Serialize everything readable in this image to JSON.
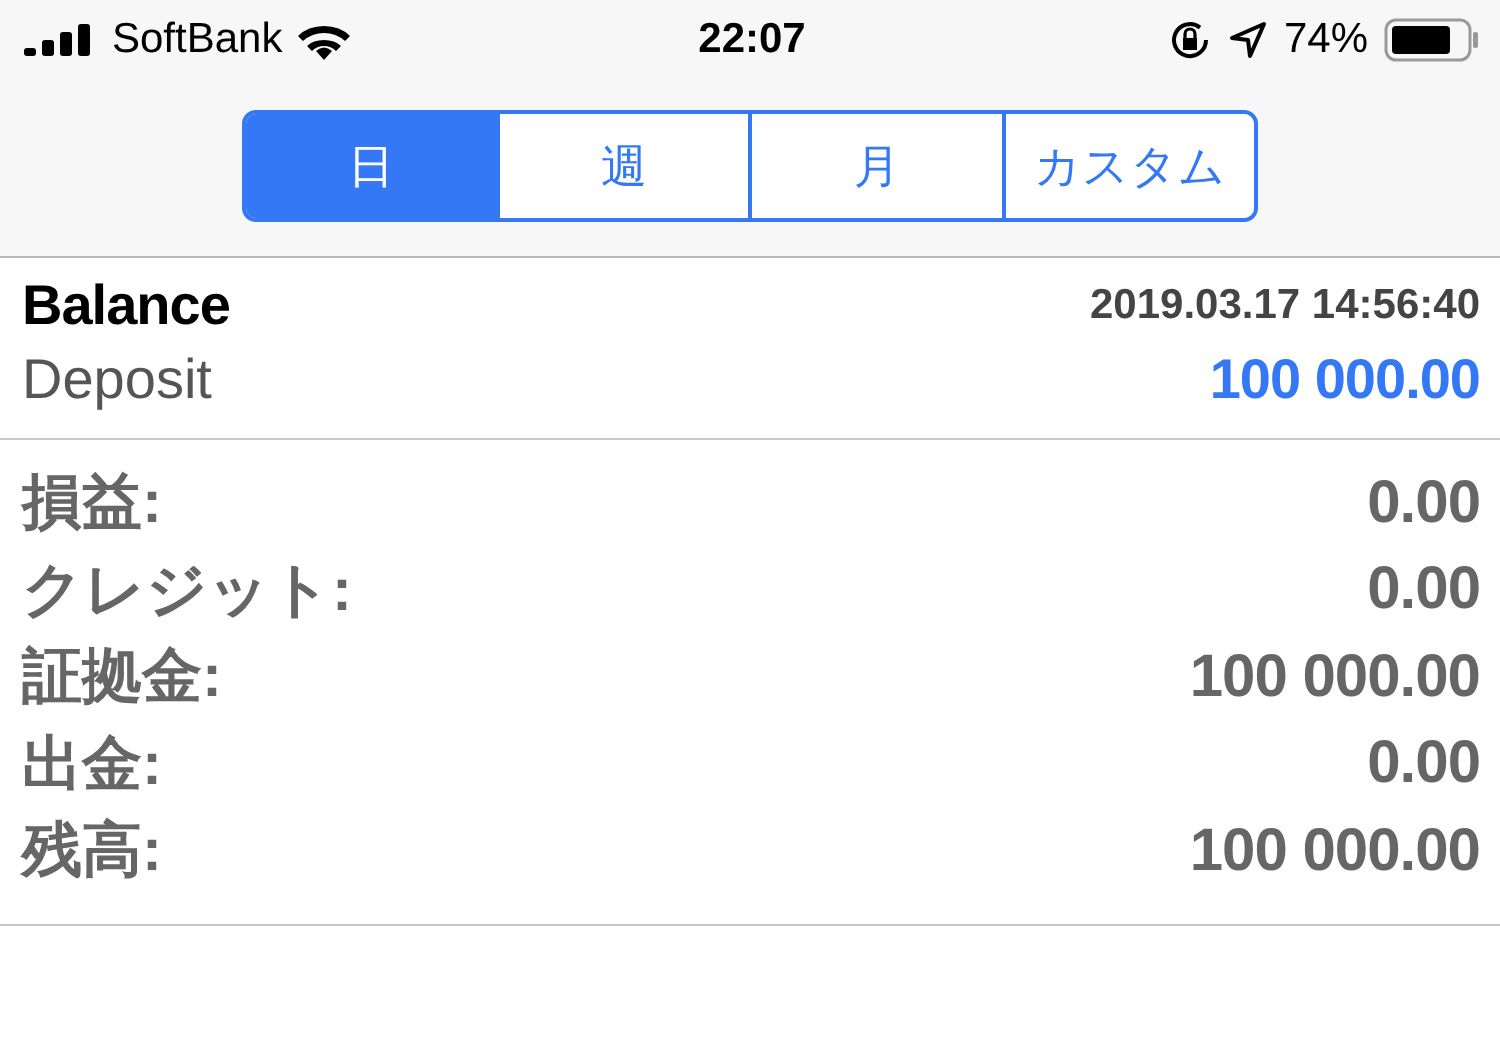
{
  "status_bar": {
    "carrier": "SoftBank",
    "time": "22:07",
    "battery": "74%"
  },
  "tabs": [
    {
      "label": "日",
      "selected": true
    },
    {
      "label": "週",
      "selected": false
    },
    {
      "label": "月",
      "selected": false
    },
    {
      "label": "カスタム",
      "selected": false
    }
  ],
  "operation": {
    "title": "Balance",
    "datetime": "2019.03.17 14:56:40",
    "type": "Deposit",
    "amount": "100 000.00"
  },
  "summary": [
    {
      "label": "損益:",
      "value": "0.00"
    },
    {
      "label": "クレジット:",
      "value": "0.00"
    },
    {
      "label": "証拠金:",
      "value": "100 000.00"
    },
    {
      "label": "出金:",
      "value": "0.00"
    },
    {
      "label": "残高:",
      "value": "100 000.00"
    }
  ]
}
